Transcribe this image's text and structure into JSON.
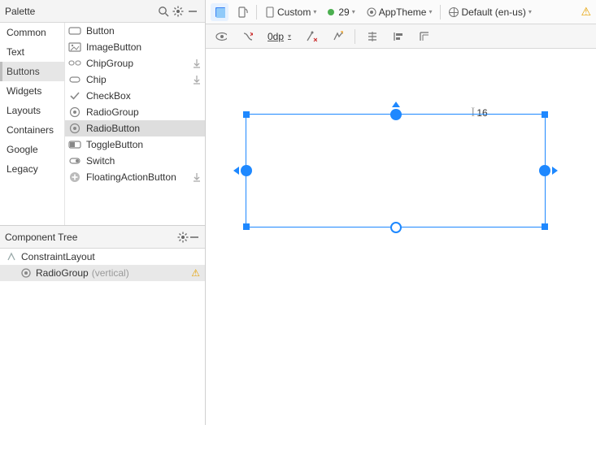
{
  "palette": {
    "title": "Palette",
    "categories": [
      "Common",
      "Text",
      "Buttons",
      "Widgets",
      "Layouts",
      "Containers",
      "Google",
      "Legacy"
    ],
    "selected_category": "Buttons",
    "items": [
      {
        "icon": "button",
        "label": "Button",
        "dl": false
      },
      {
        "icon": "imgbtn",
        "label": "ImageButton",
        "dl": false
      },
      {
        "icon": "chipg",
        "label": "ChipGroup",
        "dl": true
      },
      {
        "icon": "chip",
        "label": "Chip",
        "dl": true
      },
      {
        "icon": "check",
        "label": "CheckBox",
        "dl": false
      },
      {
        "icon": "radiog",
        "label": "RadioGroup",
        "dl": false
      },
      {
        "icon": "radio",
        "label": "RadioButton",
        "dl": false
      },
      {
        "icon": "toggle",
        "label": "ToggleButton",
        "dl": false
      },
      {
        "icon": "switch",
        "label": "Switch",
        "dl": false
      },
      {
        "icon": "fab",
        "label": "FloatingActionButton",
        "dl": true
      }
    ],
    "selected_item": "RadioButton"
  },
  "tree": {
    "title": "Component Tree",
    "root": {
      "label": "ConstraintLayout"
    },
    "child": {
      "label": "RadioGroup",
      "detail": "(vertical)",
      "warning": true
    }
  },
  "toolbar": {
    "device": "Custom",
    "api": "29",
    "theme": "AppTheme",
    "locale": "Default (en-us)",
    "margin": "0dp"
  },
  "canvas": {
    "margin_label": "16"
  }
}
